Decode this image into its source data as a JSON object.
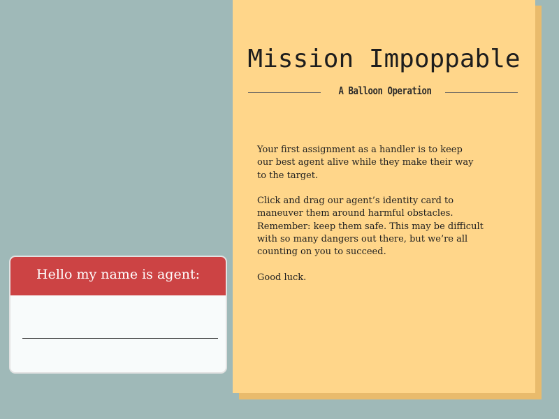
{
  "dossier": {
    "title": "Mission Impoppable",
    "subtitle": "A Balloon Operation",
    "briefing": [
      "Your first assignment as a handler is to keep\nour best agent alive while they make their way\nto the target.",
      "Click and drag our agent’s identity card to\nmaneuver them around harmful obstacles.\nRemember: keep them safe. This may be difficult\nwith so many dangers out there, but we’re all\ncounting on you to succeed.",
      "Good luck."
    ]
  },
  "name_card": {
    "header": "Hello my name is agent:",
    "name_value": ""
  },
  "colors": {
    "background": "#9fb9b8",
    "folder": "#ffd68a",
    "folder_shadow": "#e9bb6c",
    "card_header": "#cc4344",
    "card_body": "#f8fbfb"
  }
}
